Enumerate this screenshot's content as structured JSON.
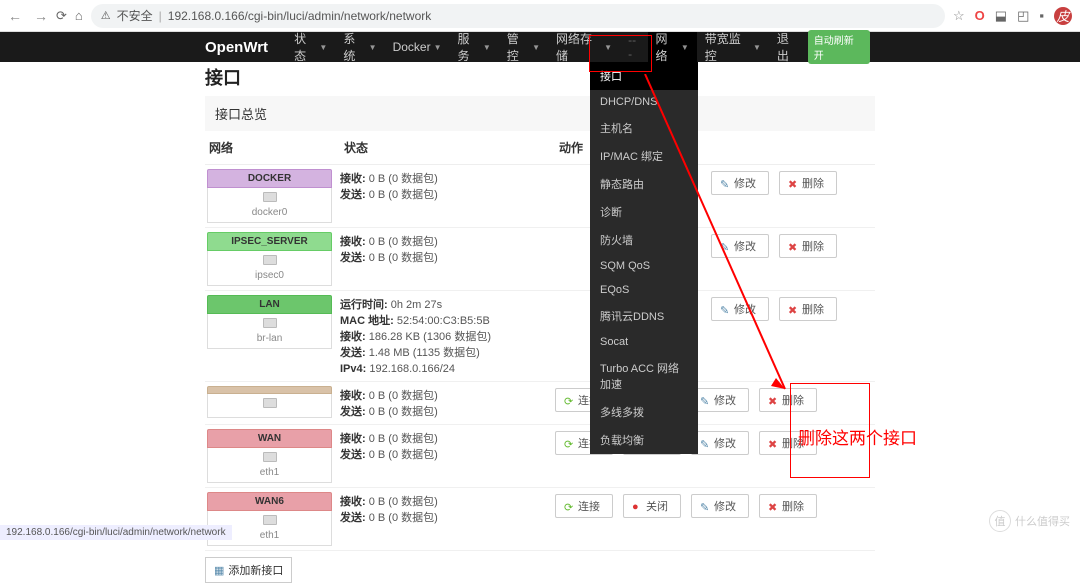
{
  "browser": {
    "url_prefix": "不安全",
    "url": "192.168.0.166/cgi-bin/luci/admin/network/network",
    "avatar": "皮"
  },
  "nav": {
    "brand": "OpenWrt",
    "items": [
      "状态",
      "系统",
      "Docker",
      "服务",
      "管控",
      "网络存储",
      "---",
      "网络",
      "带宽监控",
      "退出"
    ],
    "auto_refresh": "自动刷新 开"
  },
  "dropdown": {
    "items": [
      "接口",
      "DHCP/DNS",
      "主机名",
      "IP/MAC 绑定",
      "静态路由",
      "诊断",
      "防火墙",
      "SQM QoS",
      "EQoS",
      "腾讯云DDNS",
      "Socat",
      "Turbo ACC 网络加速",
      "多线多拨",
      "负载均衡"
    ]
  },
  "page": {
    "title": "接口",
    "section": "接口总览",
    "col_net": "网络",
    "col_status": "状态",
    "col_act": "动作"
  },
  "buttons": {
    "connect": "连接",
    "stop": "关闭",
    "edit": "修改",
    "delete": "删除",
    "add": "添加新接口"
  },
  "rows": [
    {
      "name": "DOCKER",
      "dev": "docker0",
      "hdr": "hdr-purple",
      "status": [
        [
          "接收",
          "0 B (0 数据包)"
        ],
        [
          "发送",
          "0 B (0 数据包)"
        ]
      ],
      "conn": false,
      "stop": false
    },
    {
      "name": "IPSEC_SERVER",
      "dev": "ipsec0",
      "hdr": "hdr-green",
      "status": [
        [
          "接收",
          "0 B (0 数据包)"
        ],
        [
          "发送",
          "0 B (0 数据包)"
        ]
      ],
      "conn": false,
      "stop": false
    },
    {
      "name": "LAN",
      "dev": "br-lan",
      "hdr": "hdr-green2",
      "status": [
        [
          "运行时间",
          "0h 2m 27s"
        ],
        [
          "MAC 地址",
          "52:54:00:C3:B5:5B"
        ],
        [
          "接收",
          "186.28 KB (1306 数据包)"
        ],
        [
          "发送",
          "1.48 MB (1135 数据包)"
        ],
        [
          "IPv4",
          "192.168.0.166/24"
        ]
      ],
      "conn": false,
      "stop": false
    },
    {
      "name": " ",
      "dev": " ",
      "hdr": "hdr-tan",
      "status": [
        [
          "接收",
          "0 B (0 数据包)"
        ],
        [
          "发送",
          "0 B (0 数据包)"
        ]
      ],
      "conn": true,
      "stop": true
    },
    {
      "name": "WAN",
      "dev": "eth1",
      "hdr": "hdr-pink",
      "status": [
        [
          "接收",
          "0 B (0 数据包)"
        ],
        [
          "发送",
          "0 B (0 数据包)"
        ]
      ],
      "conn": true,
      "stop": true
    },
    {
      "name": "WAN6",
      "dev": "eth1",
      "hdr": "hdr-pink2",
      "status": [
        [
          "接收",
          "0 B (0 数据包)"
        ],
        [
          "发送",
          "0 B (0 数据包)"
        ]
      ],
      "conn": true,
      "stop": true
    }
  ],
  "annotation": {
    "text": "删除这两个接口"
  },
  "statusbar": "192.168.0.166/cgi-bin/luci/admin/network/network",
  "watermark": "什么值得买"
}
